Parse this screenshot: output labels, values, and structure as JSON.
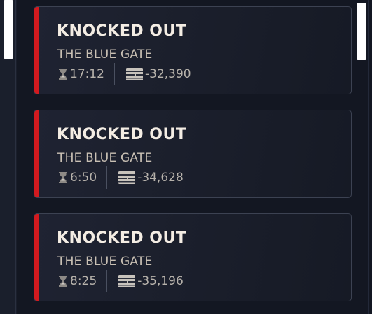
{
  "colors": {
    "accent": "#d21a1f",
    "title": "#f4ede4",
    "subtitle": "#c9c0b4",
    "stat": "#b7b2ab",
    "card_border": "#3c4252",
    "background": "#131722"
  },
  "icons": {
    "time": "hourglass-icon",
    "loot": "stash-icon"
  },
  "raids": [
    {
      "status": "KNOCKED OUT",
      "location": "THE BLUE GATE",
      "time": "17:12",
      "value": "-32,390"
    },
    {
      "status": "KNOCKED OUT",
      "location": "THE BLUE GATE",
      "time": "6:50",
      "value": "-34,628"
    },
    {
      "status": "KNOCKED OUT",
      "location": "THE BLUE GATE",
      "time": "8:25",
      "value": "-35,196"
    }
  ]
}
